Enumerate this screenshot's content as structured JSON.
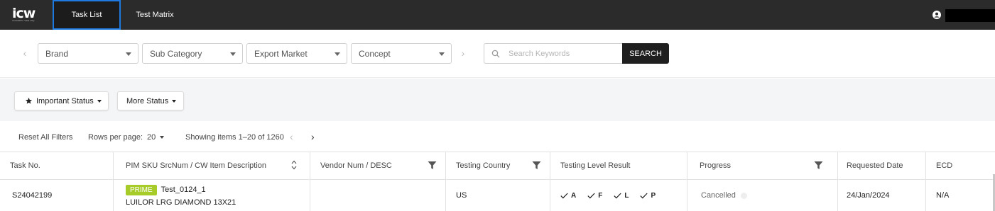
{
  "nav": {
    "logo_text": "icw",
    "logo_tagline": "consultation made easy",
    "tabs": [
      "Task List",
      "Test Matrix"
    ]
  },
  "filters": {
    "brand": "Brand",
    "sub_category": "Sub Category",
    "export_market": "Export Market",
    "concept": "Concept",
    "search_placeholder": "Search Keywords",
    "search_button": "SEARCH"
  },
  "status": {
    "important": "Important Status",
    "more": "More Status"
  },
  "tools": {
    "reset": "Reset All Filters",
    "rows_per_page_label": "Rows per page:",
    "rows_per_page_value": "20",
    "showing": "Showing items 1–20 of 1260"
  },
  "table": {
    "columns": [
      "Task No.",
      "PIM SKU SrcNum / CW Item Description",
      "Vendor Num / DESC",
      "Testing Country",
      "Testing Level Result",
      "Progress",
      "Requested Date",
      "ECD"
    ],
    "rows": [
      {
        "task_no": "S24042199",
        "badge": "PRIME",
        "sku": "Test_0124_1",
        "description": "LUILOR LRG DIAMOND 13X21",
        "vendor": "",
        "country": "US",
        "levels": [
          "A",
          "F",
          "L",
          "P"
        ],
        "progress": "Cancelled",
        "requested_date": "24/Jan/2024",
        "ecd": "N/A"
      }
    ]
  },
  "colors": {
    "topbar": "#2b2b2b",
    "active_tab_border": "#1f7ae0",
    "prime_badge": "#a7cc2a",
    "search_button": "#1f1f1f"
  }
}
